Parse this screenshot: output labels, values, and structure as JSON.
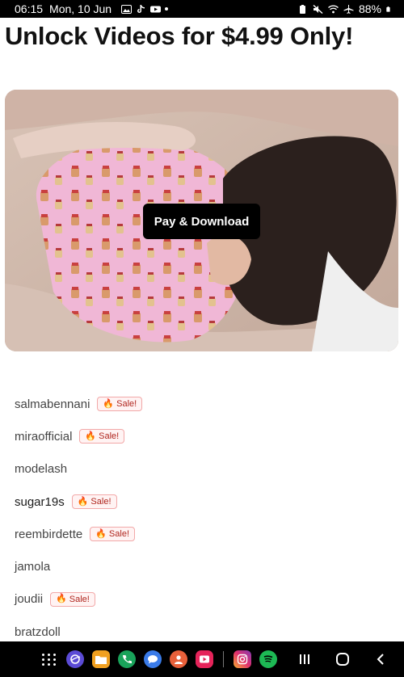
{
  "status_bar": {
    "time": "06:15",
    "date": "Mon, 10 Jun",
    "battery": "88%",
    "left_icons": [
      "gallery-icon",
      "tiktok-icon",
      "youtube-icon",
      "dot-icon"
    ],
    "right_icons": [
      "battery-saver-icon",
      "mute-icon",
      "wifi-icon",
      "airplane-icon",
      "battery-icon"
    ]
  },
  "header": {
    "title": "Unlock Videos for $4.99 Only!"
  },
  "video": {
    "pay_button_label": "Pay & Download"
  },
  "creators": {
    "sale_label": "Sale!",
    "sale_emoji": "🔥",
    "items": [
      {
        "name": "salmabennani",
        "sale": true
      },
      {
        "name": "miraofficial",
        "sale": true
      },
      {
        "name": "modelash",
        "sale": false
      },
      {
        "name": "sugar19s",
        "sale": true
      },
      {
        "name": "reembirdette",
        "sale": true
      },
      {
        "name": "jamola",
        "sale": false
      },
      {
        "name": "joudii",
        "sale": true
      },
      {
        "name": "bratzdoll",
        "sale": false
      }
    ]
  },
  "nav_bar": {
    "apps": [
      "app-drawer-icon",
      "internet-icon",
      "files-icon",
      "phone-icon",
      "messages-icon",
      "contacts-icon",
      "youtube-icon",
      "instagram-icon",
      "spotify-icon"
    ],
    "system": [
      "recents-icon",
      "home-icon",
      "back-icon"
    ]
  },
  "colors": {
    "button_bg": "#000000",
    "sale_border": "#f2a8a8",
    "sale_text": "#b0261e"
  }
}
